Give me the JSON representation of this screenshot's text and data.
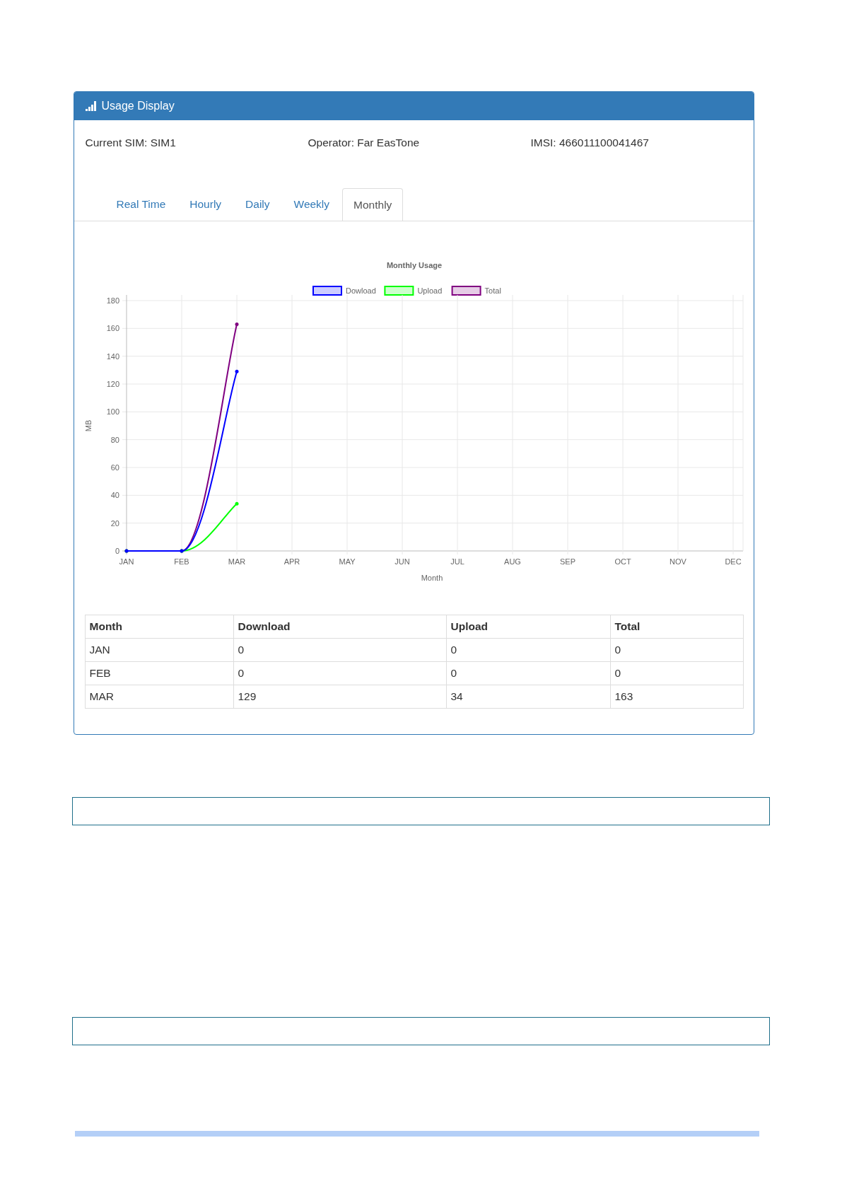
{
  "panel": {
    "title": "Usage Display"
  },
  "info": [
    "Current SIM: SIM1",
    "Operator: Far EasTone",
    "IMSI: 466011100041467"
  ],
  "tabs": [
    {
      "label": "Real Time",
      "selected": false
    },
    {
      "label": "Hourly",
      "selected": false
    },
    {
      "label": "Daily",
      "selected": false
    },
    {
      "label": "Weekly",
      "selected": false
    },
    {
      "label": "Monthly",
      "selected": true
    }
  ],
  "chart_data": {
    "type": "line",
    "title": "Monthly Usage",
    "xlabel": "Month",
    "ylabel": "MB",
    "categories": [
      "JAN",
      "FEB",
      "MAR",
      "APR",
      "MAY",
      "JUN",
      "JUL",
      "AUG",
      "SEP",
      "OCT",
      "NOV",
      "DEC"
    ],
    "series": [
      {
        "name": "Dowload",
        "color": "#0000ff",
        "values": [
          0,
          0,
          129,
          null,
          null,
          null,
          null,
          null,
          null,
          null,
          null,
          null
        ]
      },
      {
        "name": "Upload",
        "color": "#00ff00",
        "values": [
          0,
          0,
          34,
          null,
          null,
          null,
          null,
          null,
          null,
          null,
          null,
          null
        ]
      },
      {
        "name": "Total",
        "color": "#800080",
        "values": [
          0,
          0,
          163,
          null,
          null,
          null,
          null,
          null,
          null,
          null,
          null,
          null
        ]
      }
    ],
    "grid": true,
    "legend": "top",
    "ylim": [
      0,
      180
    ],
    "yticks": [
      0,
      20,
      40,
      60,
      80,
      100,
      120,
      140,
      160,
      180
    ]
  },
  "table": {
    "columns": [
      "Month",
      "Download",
      "Upload",
      "Total"
    ],
    "rows": [
      [
        "JAN",
        "0",
        "0",
        "0"
      ],
      [
        "FEB",
        "0",
        "0",
        "0"
      ],
      [
        "MAR",
        "129",
        "34",
        "163"
      ]
    ]
  }
}
